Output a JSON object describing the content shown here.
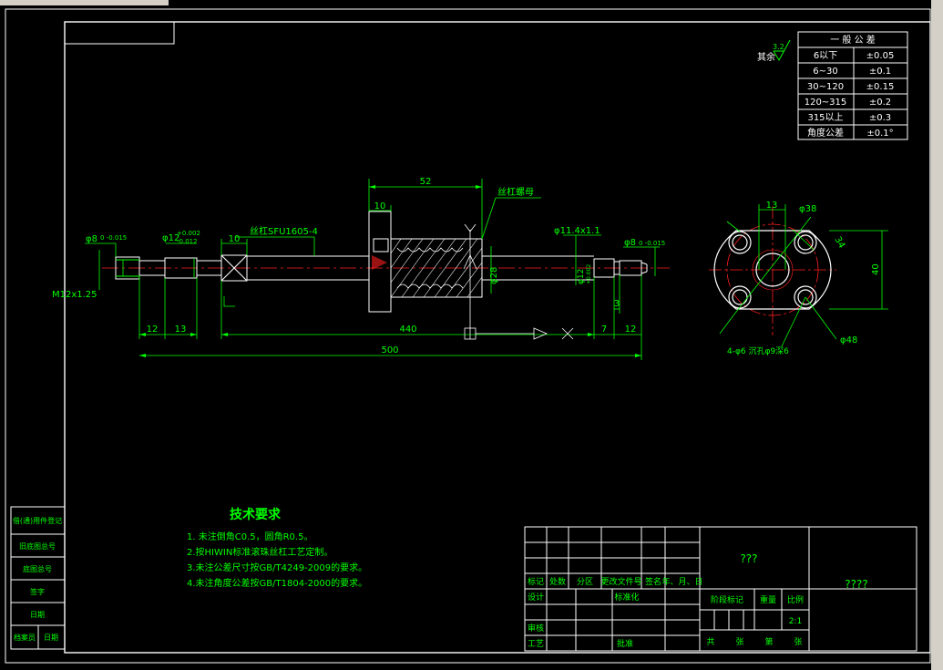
{
  "colors": {
    "background": "#000000",
    "frame": "#ffffff",
    "dimension": "#00ff00",
    "note_text": "#00ff00",
    "centerline": "#ff2020",
    "part_outline": "#ffffff",
    "hatch": "#ffffff",
    "title_text": "#00ff00",
    "mark": "#ffffff"
  },
  "general_tolerance": {
    "title": "一 般 公 差",
    "rows": [
      {
        "range": "6以下",
        "tol": "±0.05"
      },
      {
        "range": "6~30",
        "tol": "±0.1"
      },
      {
        "range": "30~120",
        "tol": "±0.15"
      },
      {
        "range": "120~315",
        "tol": "±0.2"
      },
      {
        "range": "315以上",
        "tol": "±0.3"
      },
      {
        "range": "角度公差",
        "tol": "±0.1°"
      }
    ]
  },
  "roughness": {
    "label": "其余",
    "value": "3.2"
  },
  "main_view": {
    "dims": {
      "d52": "52",
      "d10_nut": "10",
      "d10_end": "10",
      "d12_left": "12",
      "d13": "13",
      "d440": "440",
      "d500": "500",
      "d7": "7",
      "d3": "3",
      "d12_right": "12",
      "m12": "M12x1.25",
      "phi8_left": "φ8",
      "phi8_left_tol": "0 -0.015",
      "phi12_left": "φ12",
      "phi12_tol_up": "+0.002",
      "phi12_tol_low": "-0.012",
      "phi28": "φ28",
      "phi12_right": "φ12",
      "phi12_right_tol": "+0.002",
      "phi114": "φ11.4x1.1",
      "phi8_right": "φ8",
      "phi8_right_tol": "0 -0.015"
    },
    "labels": {
      "screw": "丝杠SFU1605-4",
      "nut": "丝杠螺母"
    }
  },
  "side_view": {
    "d13": "13",
    "phi38": "φ38",
    "d34": "34",
    "d40": "40",
    "phi48": "φ48",
    "holes": "4-φ6 沉孔φ9深6"
  },
  "tech_notes": {
    "title": "技术要求",
    "items": [
      "1. 未注倒角C0.5，圆角R0.5。",
      "2.按HIWIN标准滚珠丝杠工艺定制。",
      "3.未注公差尺寸按GB/T4249-2009的要求。",
      "4.未注角度公差按GB/T1804-2000的要求。"
    ]
  },
  "side_stamp": {
    "cells": [
      "借(通)用件登记",
      "旧底图总号",
      "底图总号",
      "签字",
      "日期",
      "档案员",
      "日期"
    ]
  },
  "title_block": {
    "rev_headers": [
      "标记",
      "处数",
      "分区",
      "更改文件号",
      "签名",
      "年、月、日"
    ],
    "design": "设计",
    "standardize": "标准化",
    "review": "审核",
    "process": "工艺",
    "approve": "批准",
    "stage_mark": "阶段标记",
    "weight": "重量",
    "scale": "比例",
    "scale_value": "2:1",
    "total": "共",
    "sheets": "张",
    "sheet_no": "第",
    "sheet": "张",
    "drawing_name": "???",
    "drawing_no": "????"
  }
}
